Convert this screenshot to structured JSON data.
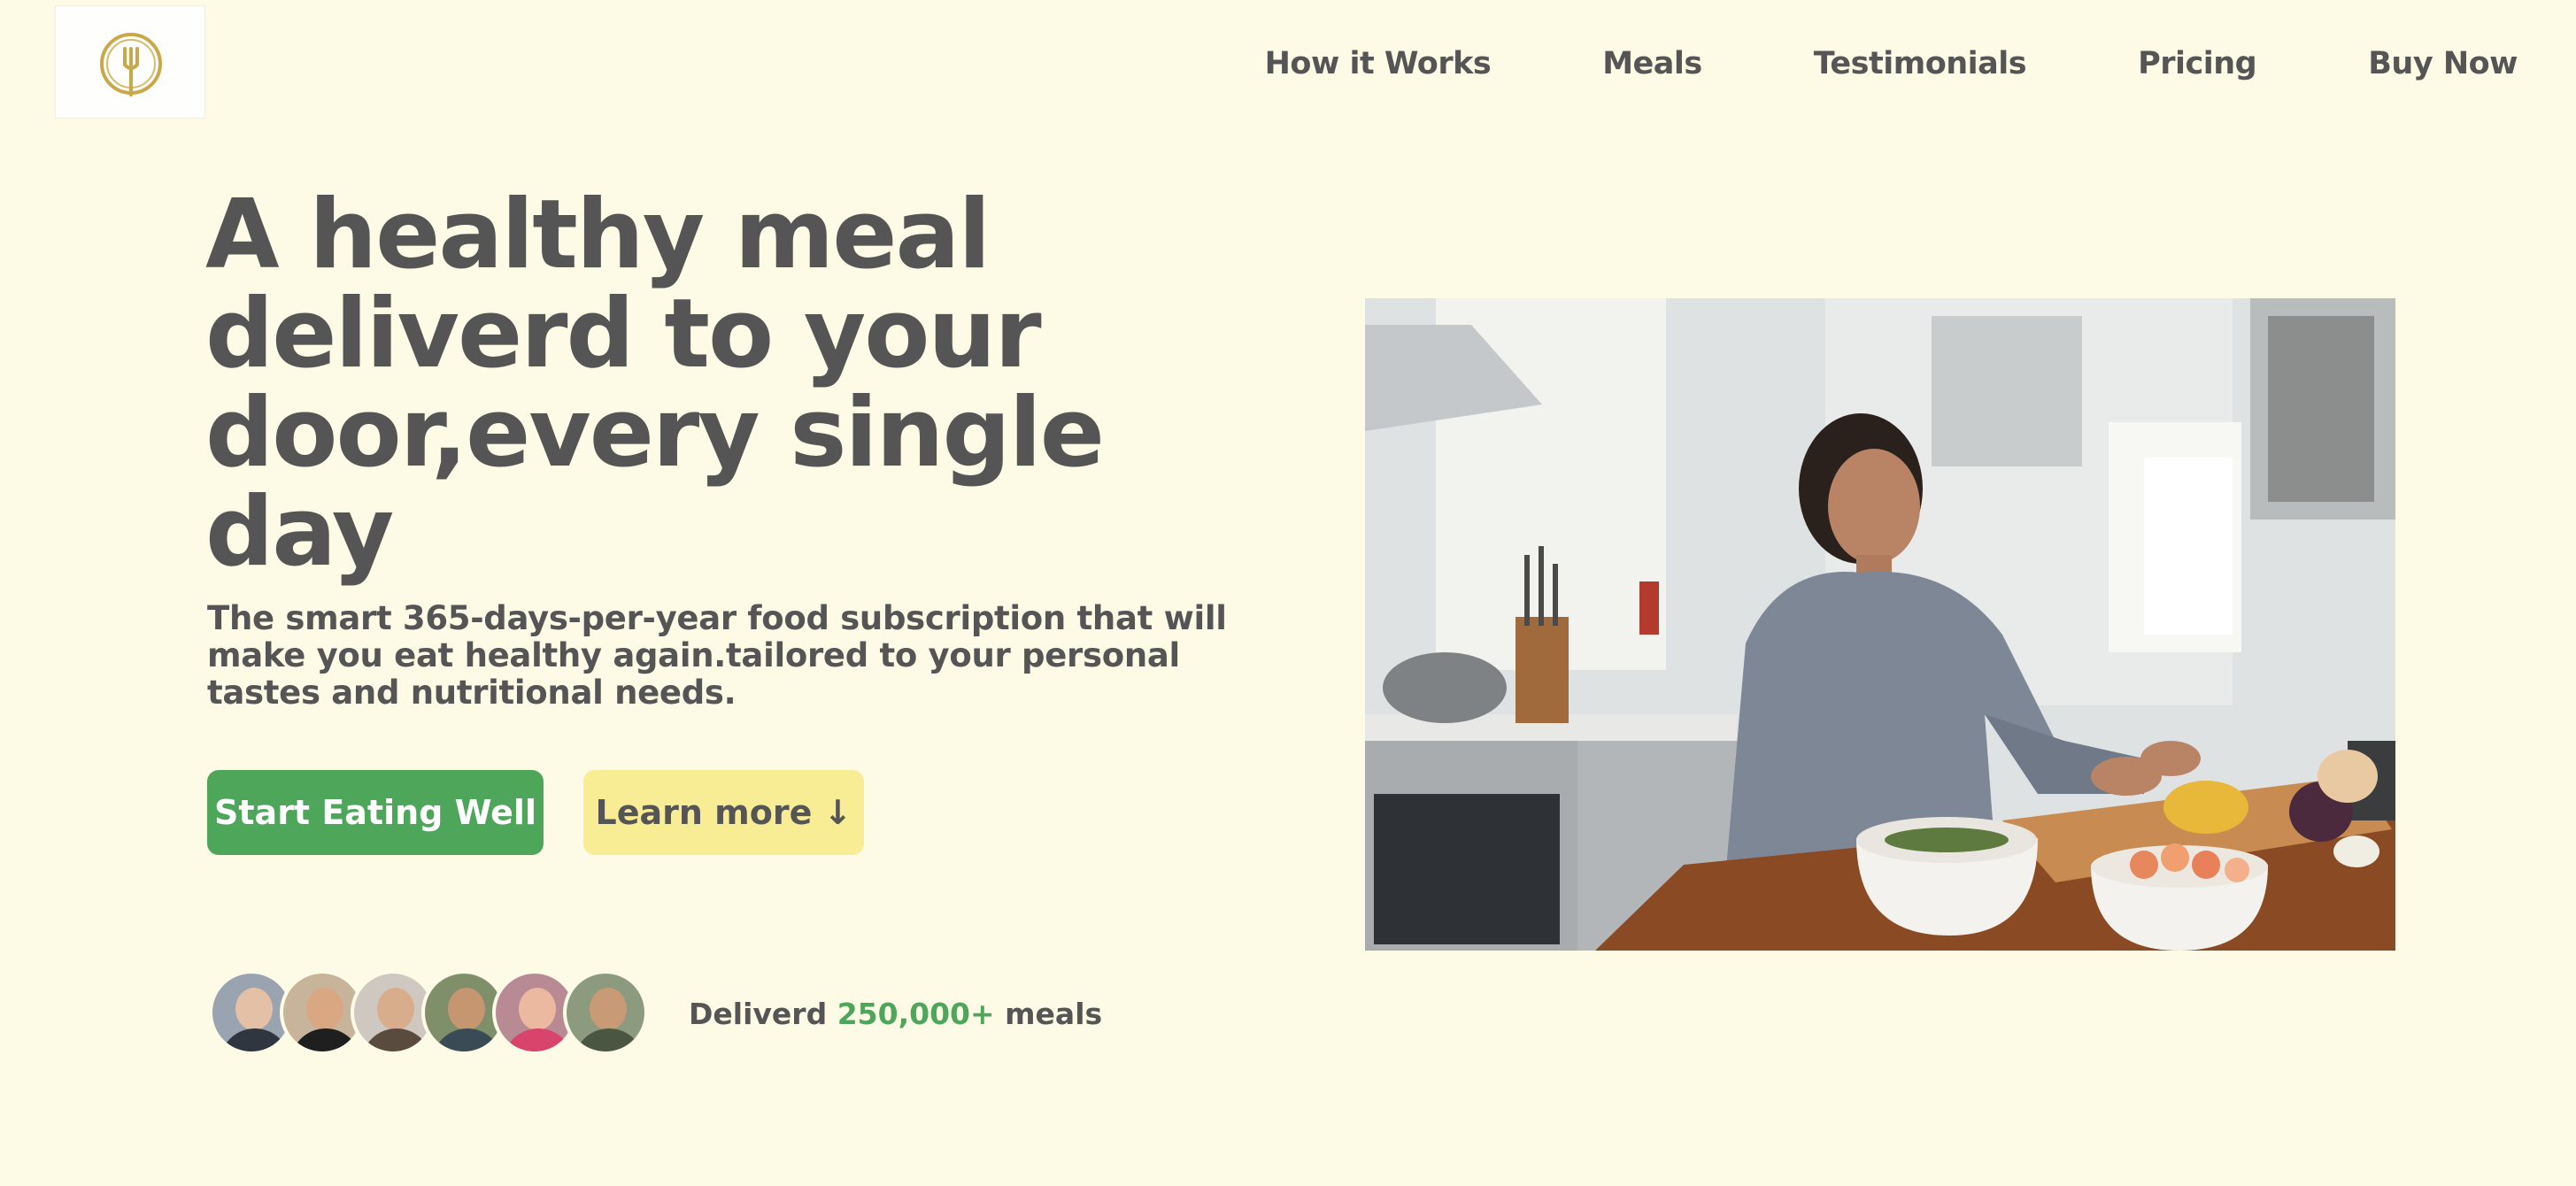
{
  "header": {
    "logo_icon": "fork-emblem-icon",
    "nav": [
      {
        "label": "How it Works"
      },
      {
        "label": "Meals"
      },
      {
        "label": "Testimonials"
      },
      {
        "label": "Pricing"
      },
      {
        "label": "Buy Now"
      }
    ]
  },
  "hero": {
    "title": "A healthy meal deliverd to your door,every single day",
    "subtitle": "The smart 365-days-per-year food subscription that will make you eat healthy again.tailored to your personal tastes and nutritional needs.",
    "primary_button": "Start Eating Well",
    "secondary_button": "Learn more ↓",
    "delivered_prefix": "Deliverd",
    "delivered_count": "250,000+",
    "delivered_suffix": "meals",
    "image_description_icon": "woman-cooking-kitchen-photo"
  },
  "colors": {
    "background": "#fdfbe6",
    "text": "#555555",
    "accent_green": "#4ea65b",
    "accent_yellow": "#f8ec95"
  }
}
